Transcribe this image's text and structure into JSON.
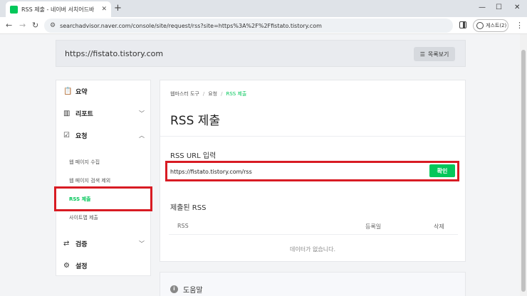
{
  "browser": {
    "tab_title": "RSS 제출 - 네이버 서치어드바",
    "address": "searchadvisor.naver.com/console/site/request/rss?site=https%3A%2F%2Ffistato.tistory.com",
    "profile_label": "게스트(2)"
  },
  "site": {
    "url": "https://fistato.tistory.com",
    "list_button": "목록보기"
  },
  "sidebar": {
    "items": [
      {
        "label": "요약",
        "icon": "clipboard-icon"
      },
      {
        "label": "리포트",
        "icon": "chart-icon"
      },
      {
        "label": "요청",
        "icon": "checkbox-icon"
      },
      {
        "label": "검증",
        "icon": "refresh-icon"
      },
      {
        "label": "설정",
        "icon": "gear-icon"
      }
    ],
    "subitems": [
      "웹 페이지 수집",
      "웹 페이지 검색 제외",
      "RSS 제출",
      "사이트맵 제출"
    ]
  },
  "main": {
    "breadcrumb": [
      "웹마스터 도구",
      "요청",
      "RSS 제출"
    ],
    "title": "RSS 제출",
    "rss_section_title": "RSS URL 입력",
    "rss_input_value": "https://fistato.tistory.com/rss",
    "confirm_label": "확인",
    "submitted_title": "제출된 RSS",
    "table_headers": [
      "RSS",
      "등록일",
      "삭제"
    ],
    "empty_message": "데이터가 없습니다.",
    "help_title": "도움말"
  },
  "colors": {
    "accent": "#03c75a",
    "highlight": "#d81b23"
  }
}
